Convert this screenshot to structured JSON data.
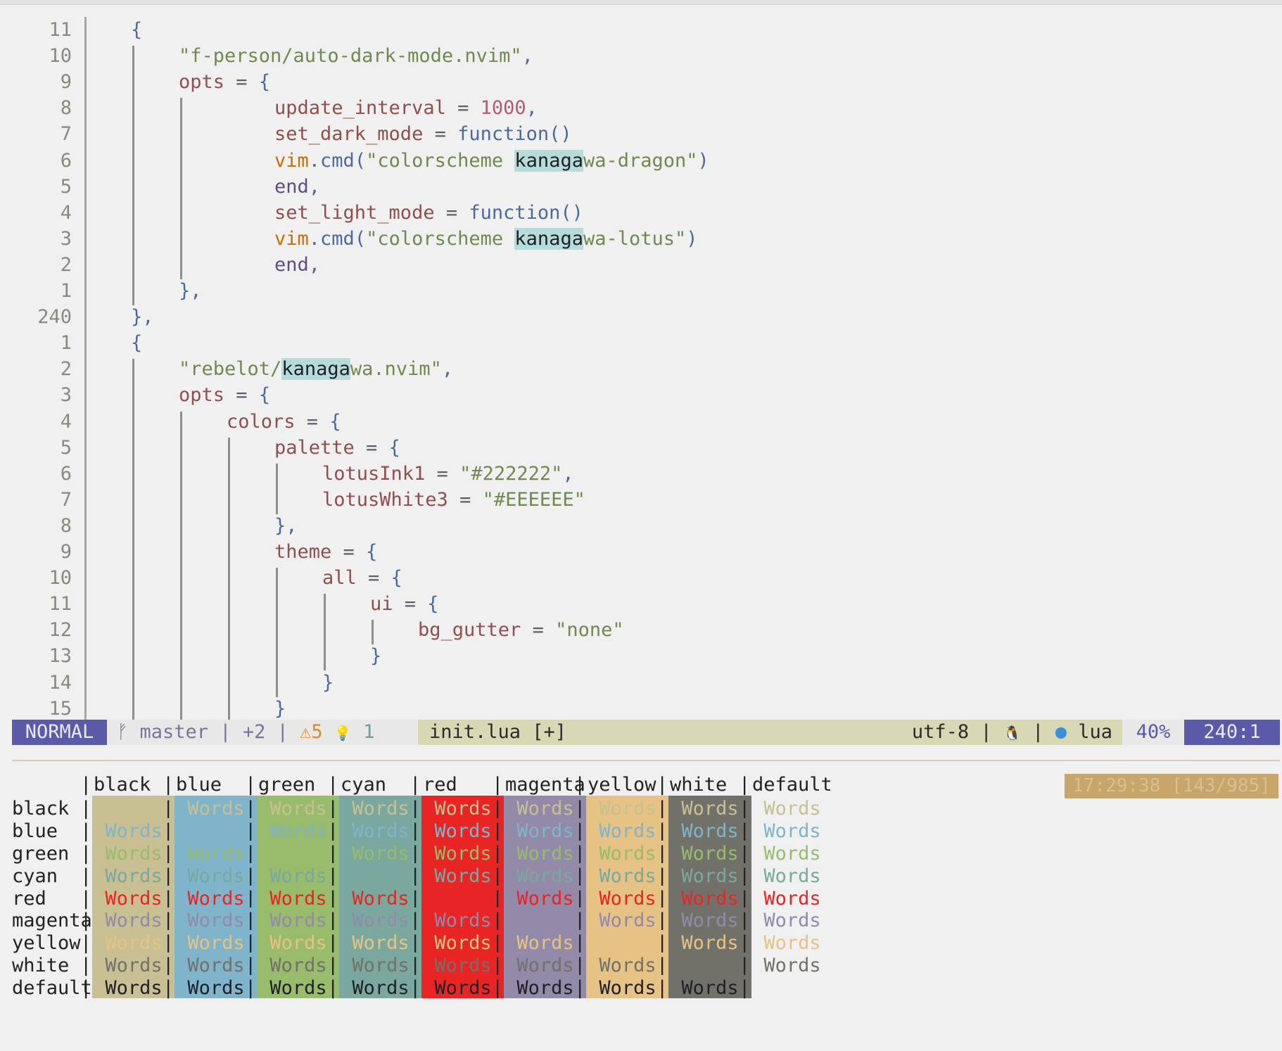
{
  "editor": {
    "lines": [
      {
        "num": "11",
        "indent": 0,
        "tokens": [
          [
            "p",
            "{"
          ]
        ]
      },
      {
        "num": "10",
        "indent": 1,
        "tokens": [
          [
            "s",
            "\"f-person/auto-dark-mode.nvim\""
          ],
          [
            "p",
            ","
          ]
        ]
      },
      {
        "num": "9",
        "indent": 1,
        "tokens": [
          [
            "v",
            "opts"
          ],
          [
            "o",
            " = "
          ],
          [
            "p",
            "{"
          ]
        ]
      },
      {
        "num": "8",
        "indent": 3,
        "tokens": [
          [
            "v",
            "update_interval"
          ],
          [
            "o",
            " = "
          ],
          [
            "n",
            "1000"
          ],
          [
            "p",
            ","
          ]
        ]
      },
      {
        "num": "7",
        "indent": 3,
        "tokens": [
          [
            "v",
            "set_dark_mode"
          ],
          [
            "o",
            " = "
          ],
          [
            "f",
            "function"
          ],
          [
            "p",
            "()"
          ]
        ]
      },
      {
        "num": "6",
        "indent": 3,
        "tokens": [
          [
            "b",
            "vim"
          ],
          [
            "p",
            "."
          ],
          [
            "f",
            "cmd"
          ],
          [
            "p",
            "("
          ],
          [
            "s",
            "\"colorscheme "
          ],
          [
            "hl",
            "kanaga"
          ],
          [
            "s",
            "wa-dragon\""
          ],
          [
            "p",
            ")"
          ]
        ]
      },
      {
        "num": "5",
        "indent": 3,
        "tokens": [
          [
            "k",
            "end"
          ],
          [
            "p",
            ","
          ]
        ]
      },
      {
        "num": "4",
        "indent": 3,
        "tokens": [
          [
            "v",
            "set_light_mode"
          ],
          [
            "o",
            " = "
          ],
          [
            "f",
            "function"
          ],
          [
            "p",
            "()"
          ]
        ]
      },
      {
        "num": "3",
        "indent": 3,
        "tokens": [
          [
            "b",
            "vim"
          ],
          [
            "p",
            "."
          ],
          [
            "f",
            "cmd"
          ],
          [
            "p",
            "("
          ],
          [
            "s",
            "\"colorscheme "
          ],
          [
            "hl",
            "kanaga"
          ],
          [
            "s",
            "wa-lotus\""
          ],
          [
            "p",
            ")"
          ]
        ]
      },
      {
        "num": "2",
        "indent": 3,
        "tokens": [
          [
            "k",
            "end"
          ],
          [
            "p",
            ","
          ]
        ]
      },
      {
        "num": "1",
        "indent": 1,
        "tokens": [
          [
            "p",
            "},"
          ]
        ]
      },
      {
        "num": "240",
        "indent": 0,
        "tokens": [
          [
            "p",
            "},"
          ]
        ]
      },
      {
        "num": "1",
        "indent": 0,
        "tokens": [
          [
            "p",
            "{"
          ]
        ]
      },
      {
        "num": "2",
        "indent": 1,
        "tokens": [
          [
            "s",
            "\"rebelot/"
          ],
          [
            "hl",
            "kanaga"
          ],
          [
            "s",
            "wa.nvim\""
          ],
          [
            "p",
            ","
          ]
        ]
      },
      {
        "num": "3",
        "indent": 1,
        "tokens": [
          [
            "v",
            "opts"
          ],
          [
            "o",
            " = "
          ],
          [
            "p",
            "{"
          ]
        ]
      },
      {
        "num": "4",
        "indent": 2,
        "tokens": [
          [
            "v",
            "colors"
          ],
          [
            "o",
            " = "
          ],
          [
            "p",
            "{"
          ]
        ]
      },
      {
        "num": "5",
        "indent": 3,
        "tokens": [
          [
            "v",
            "palette"
          ],
          [
            "o",
            " = "
          ],
          [
            "p",
            "{"
          ]
        ]
      },
      {
        "num": "6",
        "indent": 4,
        "tokens": [
          [
            "v",
            "lotusInk1"
          ],
          [
            "o",
            " = "
          ],
          [
            "s",
            "\"#222222\""
          ],
          [
            "p",
            ","
          ]
        ]
      },
      {
        "num": "7",
        "indent": 4,
        "tokens": [
          [
            "v",
            "lotusWhite3"
          ],
          [
            "o",
            " = "
          ],
          [
            "s",
            "\"#EEEEEE\""
          ]
        ]
      },
      {
        "num": "8",
        "indent": 3,
        "tokens": [
          [
            "p",
            "},"
          ]
        ]
      },
      {
        "num": "9",
        "indent": 3,
        "tokens": [
          [
            "v",
            "theme"
          ],
          [
            "o",
            " = "
          ],
          [
            "p",
            "{"
          ]
        ]
      },
      {
        "num": "10",
        "indent": 4,
        "tokens": [
          [
            "v",
            "all"
          ],
          [
            "o",
            " = "
          ],
          [
            "p",
            "{"
          ]
        ]
      },
      {
        "num": "11",
        "indent": 5,
        "tokens": [
          [
            "v",
            "ui"
          ],
          [
            "o",
            " = "
          ],
          [
            "p",
            "{"
          ]
        ]
      },
      {
        "num": "12",
        "indent": 6,
        "tokens": [
          [
            "v",
            "bg_gutter"
          ],
          [
            "o",
            " = "
          ],
          [
            "s",
            "\"none\""
          ]
        ]
      },
      {
        "num": "13",
        "indent": 5,
        "tokens": [
          [
            "p",
            "}"
          ]
        ]
      },
      {
        "num": "14",
        "indent": 4,
        "tokens": [
          [
            "p",
            "}"
          ]
        ]
      },
      {
        "num": "15",
        "indent": 3,
        "tokens": [
          [
            "p",
            "}"
          ]
        ]
      }
    ]
  },
  "statusline": {
    "mode": "NORMAL",
    "branch_icon": "ᚠ",
    "branch": "master",
    "sep": "|",
    "added": "+2",
    "warn_icon": "⚠",
    "warn_count": "5",
    "hint_icon": "💡",
    "hint_count": "1",
    "filename": "init.lua [+]",
    "encoding": "utf-8",
    "os_icon": "🐧",
    "lua_icon": "●",
    "filetype": "lua",
    "percent": "40%",
    "position": "240:1"
  },
  "clock": "17:29:38 [143/985]",
  "table": {
    "headers": [
      "black",
      "blue",
      "green",
      "cyan",
      "red",
      "magenta",
      "yellow",
      "white",
      "default"
    ],
    "rows": [
      "black",
      "blue",
      "green",
      "cyan",
      "red",
      "magenta",
      "yellow",
      "white",
      "default"
    ],
    "word": "Words",
    "colors": {
      "black": "#c8c093",
      "blue": "#7fb4ca",
      "green": "#98bb6c",
      "cyan": "#7aa89f",
      "red": "#e82424",
      "magenta": "#938aa9",
      "yellow": "#e6c384",
      "white": "#727169",
      "default": "#1f1f28"
    }
  }
}
